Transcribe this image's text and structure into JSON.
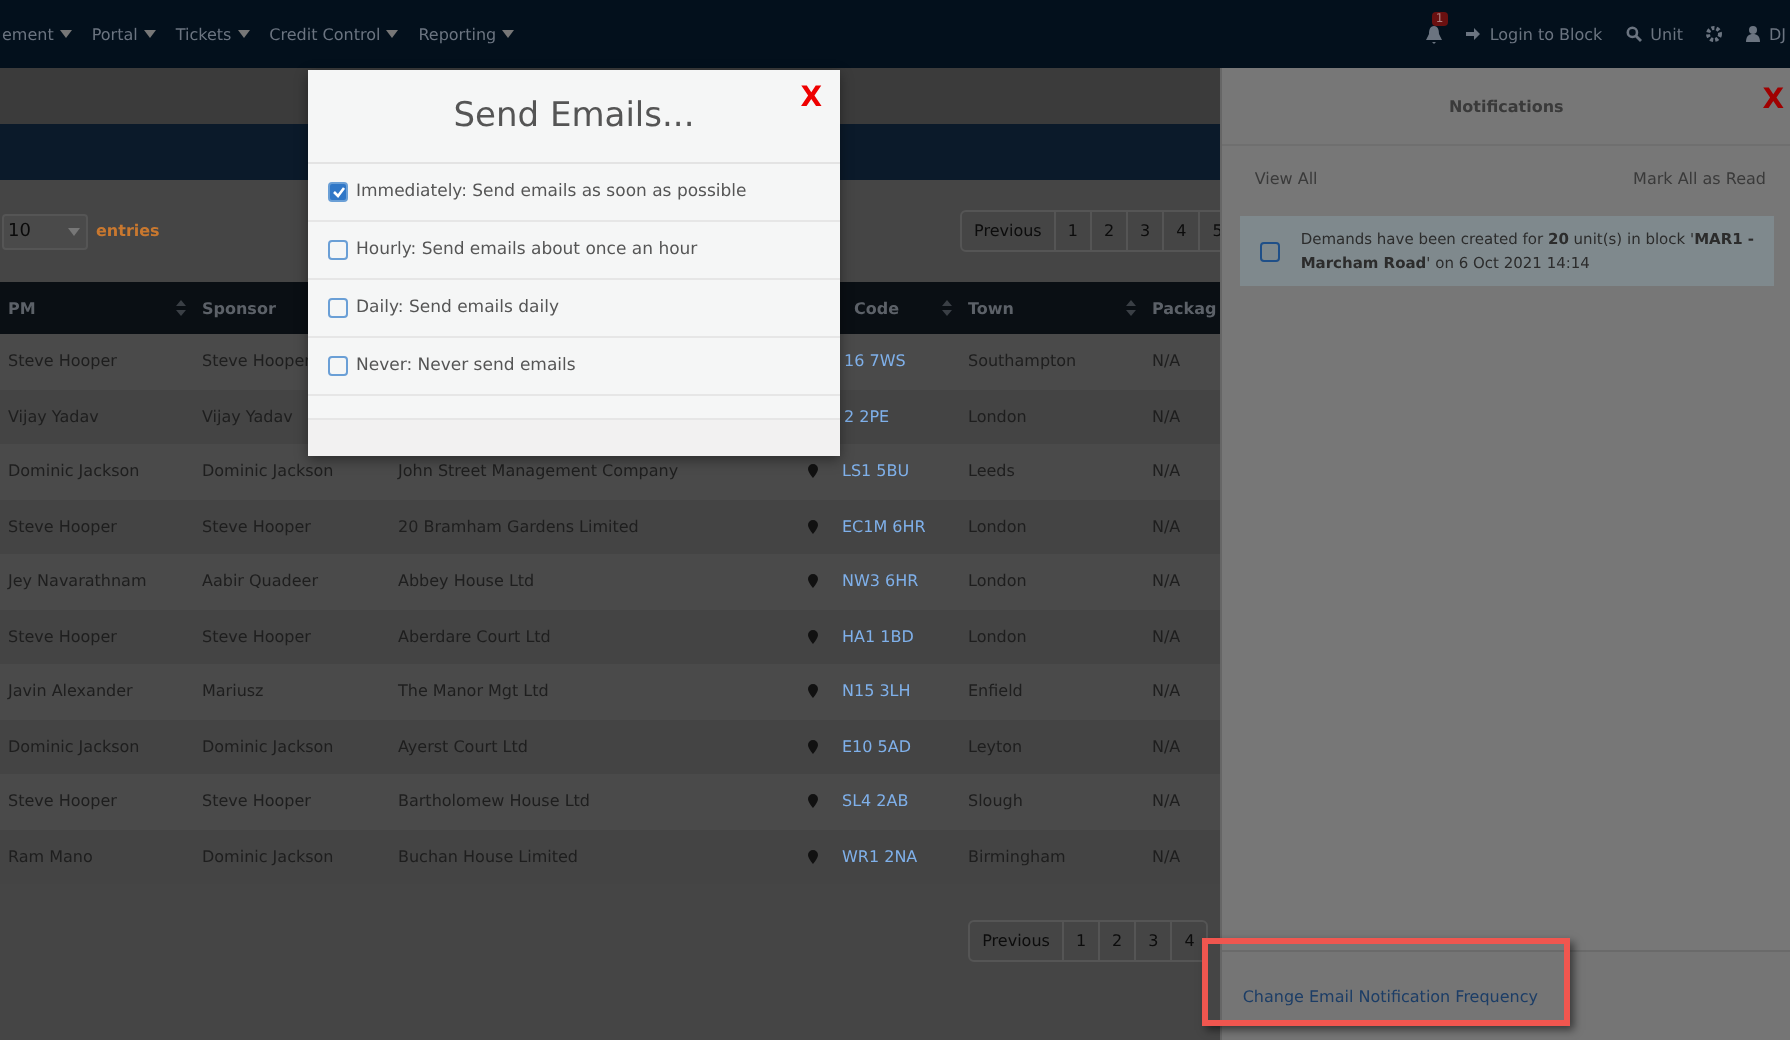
{
  "navbar": {
    "menus": [
      "ement",
      "Portal",
      "Tickets",
      "Credit Control",
      "Reporting"
    ],
    "notification_count": "1",
    "login_to_block": "Login to Block",
    "unit": "Unit",
    "user": "DJ"
  },
  "table_controls": {
    "page_size": "10",
    "entries_label": "entries",
    "pages": [
      "Previous",
      "1",
      "2",
      "3",
      "4",
      "5"
    ]
  },
  "table": {
    "columns": [
      "PM",
      "Sponsor",
      "Code",
      "Town",
      "Packag"
    ],
    "rows": [
      {
        "pm": "Steve Hooper",
        "sponsor": "Steve Hooper",
        "name": "",
        "code": "16 7WS",
        "town": "Southampton",
        "package": "N/A"
      },
      {
        "pm": "Vijay Yadav",
        "sponsor": "Vijay Yadav",
        "name": "",
        "code": "2 2PE",
        "town": "London",
        "package": "N/A"
      },
      {
        "pm": "Dominic Jackson",
        "sponsor": "Dominic Jackson",
        "name": "John Street Management Company",
        "code": "LS1 5BU",
        "town": "Leeds",
        "package": "N/A"
      },
      {
        "pm": "Steve Hooper",
        "sponsor": "Steve Hooper",
        "name": "20 Bramham Gardens Limited",
        "code": "EC1M 6HR",
        "town": "London",
        "package": "N/A"
      },
      {
        "pm": "Jey Navarathnam",
        "sponsor": "Aabir Quadeer",
        "name": "Abbey House Ltd",
        "code": "NW3 6HR",
        "town": "London",
        "package": "N/A"
      },
      {
        "pm": "Steve Hooper",
        "sponsor": "Steve Hooper",
        "name": "Aberdare Court Ltd",
        "code": "HA1 1BD",
        "town": "London",
        "package": "N/A"
      },
      {
        "pm": "Javin Alexander",
        "sponsor": "Mariusz",
        "name": "The Manor Mgt Ltd",
        "code": "N15 3LH",
        "town": "Enfield",
        "package": "N/A"
      },
      {
        "pm": "Dominic Jackson",
        "sponsor": "Dominic Jackson",
        "name": "Ayerst Court Ltd",
        "code": "E10 5AD",
        "town": "Leyton",
        "package": "N/A"
      },
      {
        "pm": "Steve Hooper",
        "sponsor": "Steve Hooper",
        "name": "Bartholomew House Ltd",
        "code": "SL4 2AB",
        "town": "Slough",
        "package": "N/A"
      },
      {
        "pm": "Ram Mano",
        "sponsor": "Dominic Jackson",
        "name": "Buchan House Limited",
        "code": "WR1 2NA",
        "town": "Birmingham",
        "package": "N/A"
      }
    ]
  },
  "bottom_pages": [
    "Previous",
    "1",
    "2",
    "3",
    "4"
  ],
  "notifications": {
    "title": "Notifications",
    "view_all": "View All",
    "mark_all_read": "Mark All as Read",
    "items": [
      {
        "text": "Demands have been created for **20** unit(s) in block '**MAR1 - Marcham Road**' on 6 Oct 2021 14:14",
        "checked": false
      }
    ],
    "footer_link": "Change Email Notification Frequency"
  },
  "modal": {
    "title": "Send Emails...",
    "close": "X",
    "options": [
      {
        "label": "Immediately: Send emails as soon as possible",
        "checked": true
      },
      {
        "label": "Hourly: Send emails about once an hour",
        "checked": false
      },
      {
        "label": "Daily: Send emails daily",
        "checked": false
      },
      {
        "label": "Never: Never send emails",
        "checked": false
      }
    ]
  },
  "panel_close": "X"
}
